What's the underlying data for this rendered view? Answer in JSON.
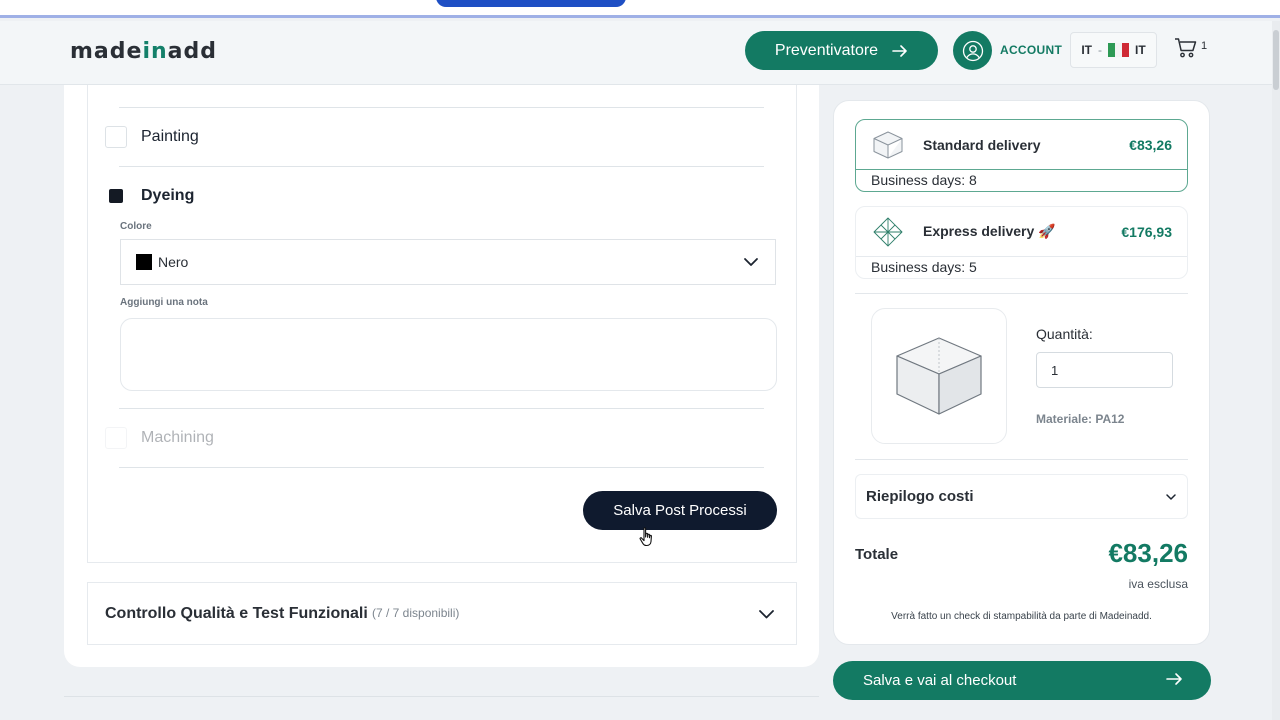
{
  "header": {
    "logo_pre": "made",
    "logo_in": "in",
    "logo_post": "add",
    "preventivatore_label": "Preventivatore",
    "account_label": "ACCOUNT",
    "lang_left": "IT",
    "lang_sep": "-",
    "lang_right": "IT",
    "cart_count": "1"
  },
  "post_processing": {
    "options": [
      {
        "label": "Painting",
        "checked": false
      },
      {
        "label": "Dyeing",
        "checked": true
      },
      {
        "label": "Machining",
        "checked": false
      }
    ],
    "color_label": "Colore",
    "color_value": "Nero",
    "note_label": "Aggiungi una nota",
    "save_label": "Salva Post Processi"
  },
  "quality": {
    "title": "Controllo Qualità e Test Funzionali",
    "count": "(7 / 7 disponibili)"
  },
  "delivery": [
    {
      "name": "Standard delivery",
      "price": "€83,26",
      "days": "Business days: 8",
      "selected": true
    },
    {
      "name": "Express delivery 🚀",
      "price": "€176,93",
      "days": "Business days: 5",
      "selected": false
    }
  ],
  "item": {
    "quantity_label": "Quantità:",
    "quantity_value": "1",
    "material": "Materiale: PA12"
  },
  "summary": {
    "riepilogo_label": "Riepilogo costi",
    "totale_label": "Totale",
    "totale_value": "€83,26",
    "iva_label": "iva esclusa",
    "check_note": "Verrà fatto un check di stampabilità da parte di Madeinadd."
  },
  "checkout_label": "Salva e vai al checkout",
  "colors": {
    "brand_green": "#137a63",
    "dark_navy": "#0f1a2e"
  }
}
